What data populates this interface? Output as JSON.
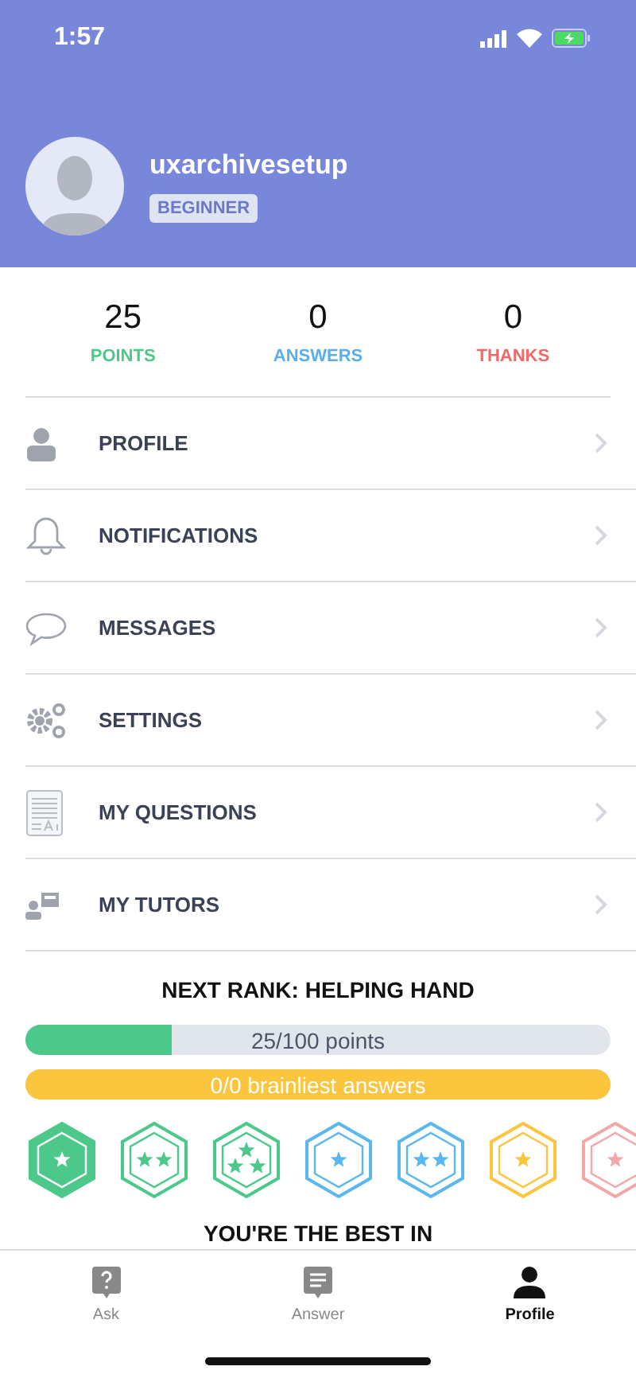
{
  "status_bar": {
    "time": "1:57"
  },
  "profile": {
    "username": "uxarchivesetup",
    "rank": "BEGINNER"
  },
  "stats": [
    {
      "value": "25",
      "label": "POINTS",
      "color": "#4cc98a"
    },
    {
      "value": "0",
      "label": "ANSWERS",
      "color": "#5aaeea"
    },
    {
      "value": "0",
      "label": "THANKS",
      "color": "#f06a6a"
    }
  ],
  "menu": [
    {
      "kind": "person",
      "label": "PROFILE"
    },
    {
      "kind": "bell",
      "label": "NOTIFICATIONS"
    },
    {
      "kind": "bubble",
      "label": "MESSAGES"
    },
    {
      "kind": "gears",
      "label": "SETTINGS"
    },
    {
      "kind": "document",
      "label": "MY QUESTIONS"
    },
    {
      "kind": "tutor",
      "label": "MY TUTORS"
    }
  ],
  "next_rank": {
    "title": "NEXT RANK: HELPING HAND",
    "progress": [
      {
        "label": "25/100 points",
        "level": 0.25,
        "color": "#4cc98a"
      },
      {
        "label": "0/0 brainliest answers",
        "level": 1,
        "color": "#fbc63e"
      }
    ],
    "badges": [
      {
        "kind": "single",
        "color": "#4cc98a",
        "earned": true
      },
      {
        "kind": "double",
        "color": "#4cc98a",
        "earned": false
      },
      {
        "kind": "triple",
        "color": "#4cc98a",
        "earned": false
      },
      {
        "kind": "single",
        "color": "#5ab8ee",
        "earned": false
      },
      {
        "kind": "double",
        "color": "#5ab8ee",
        "earned": false
      },
      {
        "kind": "single",
        "color": "#fbc63e",
        "earned": false
      },
      {
        "kind": "single",
        "color": "#f2a8a8",
        "earned": false
      }
    ]
  },
  "best_in": {
    "title": "YOU'RE THE BEST IN"
  },
  "tab_bar": [
    {
      "kind": "ask",
      "label": "Ask",
      "selected": false
    },
    {
      "kind": "answer",
      "label": "Answer",
      "selected": false
    },
    {
      "kind": "profile",
      "label": "Profile",
      "selected": true
    }
  ]
}
